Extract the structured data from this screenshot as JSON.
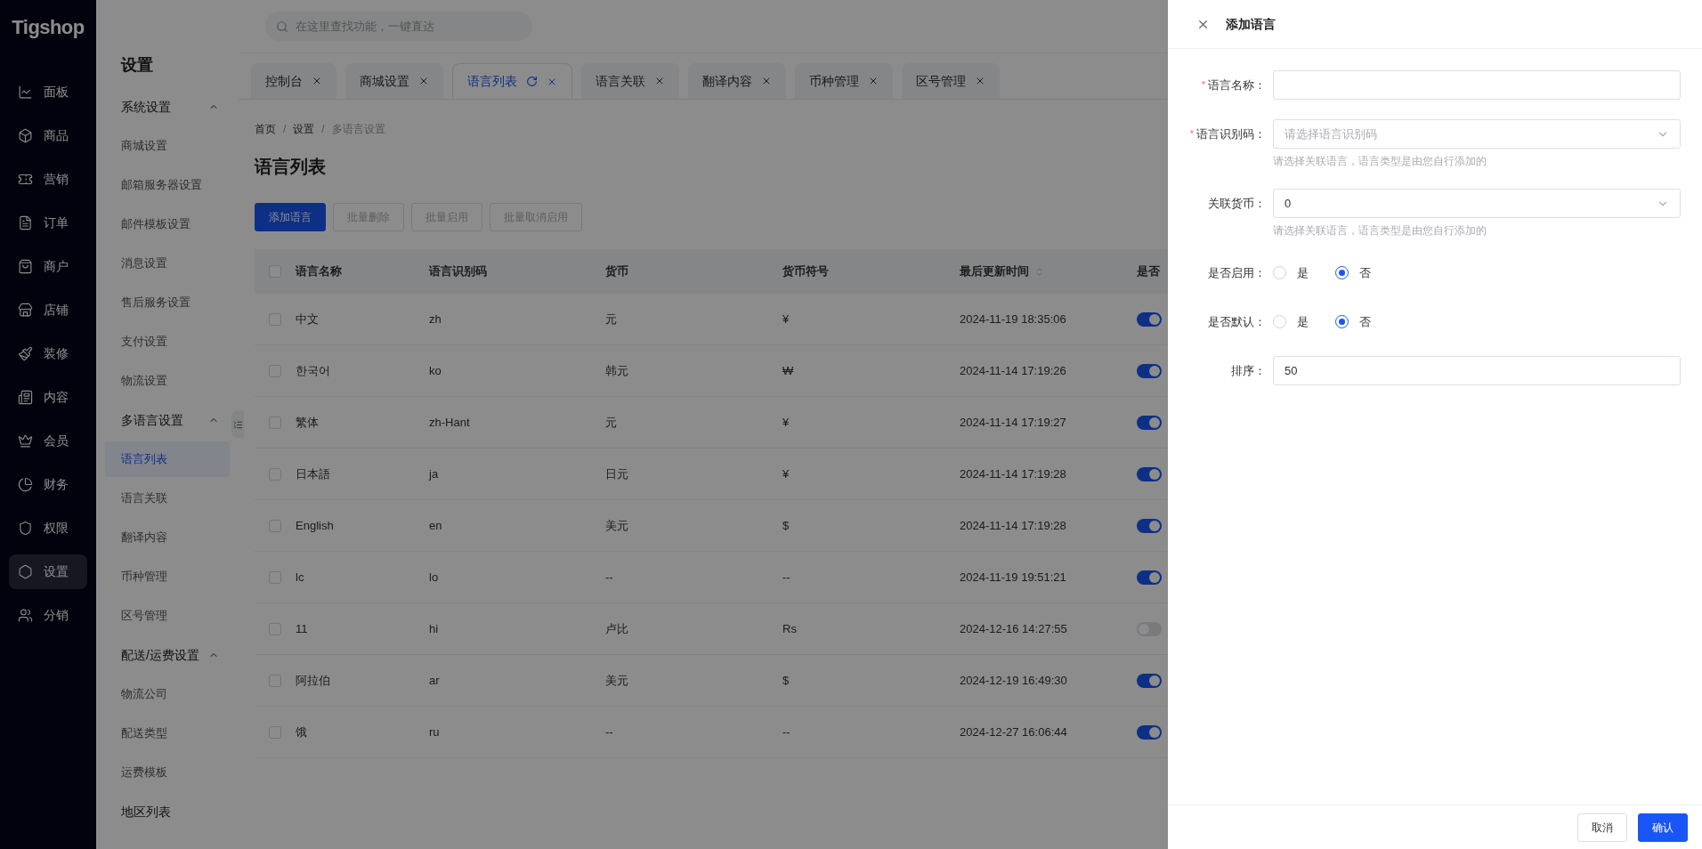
{
  "logo": "Tigshop",
  "search": {
    "placeholder": "在这里查找功能，一键直达"
  },
  "nav": [
    {
      "label": "面板",
      "selected": false
    },
    {
      "label": "商品",
      "selected": false
    },
    {
      "label": "营销",
      "selected": false
    },
    {
      "label": "订单",
      "selected": false
    },
    {
      "label": "商户",
      "selected": false
    },
    {
      "label": "店铺",
      "selected": false
    },
    {
      "label": "装修",
      "selected": false
    },
    {
      "label": "内容",
      "selected": false
    },
    {
      "label": "会员",
      "selected": false
    },
    {
      "label": "财务",
      "selected": false
    },
    {
      "label": "权限",
      "selected": false
    },
    {
      "label": "设置",
      "selected": true
    },
    {
      "label": "分销",
      "selected": false
    }
  ],
  "submenu": {
    "title": "设置",
    "groups": [
      {
        "kind": "group",
        "label": "系统设置",
        "expanded": true,
        "items": [
          {
            "label": "商城设置",
            "selected": false
          },
          {
            "label": "邮箱服务器设置",
            "selected": false
          },
          {
            "label": "邮件模板设置",
            "selected": false
          },
          {
            "label": "消息设置",
            "selected": false
          },
          {
            "label": "售后服务设置",
            "selected": false
          },
          {
            "label": "支付设置",
            "selected": false
          },
          {
            "label": "物流设置",
            "selected": false
          }
        ]
      },
      {
        "kind": "group",
        "label": "多语言设置",
        "expanded": true,
        "items": [
          {
            "label": "语言列表",
            "selected": true
          },
          {
            "label": "语言关联",
            "selected": false
          },
          {
            "label": "翻译内容",
            "selected": false
          },
          {
            "label": "币种管理",
            "selected": false
          },
          {
            "label": "区号管理",
            "selected": false
          }
        ]
      },
      {
        "kind": "group",
        "label": "配送/运费设置",
        "expanded": true,
        "items": [
          {
            "label": "物流公司",
            "selected": false
          },
          {
            "label": "配送类型",
            "selected": false
          },
          {
            "label": "运费模板",
            "selected": false
          }
        ]
      },
      {
        "kind": "link",
        "label": "地区列表"
      }
    ]
  },
  "tabs": [
    {
      "label": "控制台",
      "selected": false
    },
    {
      "label": "商城设置",
      "selected": false
    },
    {
      "label": "语言列表",
      "selected": true
    },
    {
      "label": "语言关联",
      "selected": false
    },
    {
      "label": "翻译内容",
      "selected": false
    },
    {
      "label": "币种管理",
      "selected": false
    },
    {
      "label": "区号管理",
      "selected": false
    }
  ],
  "breadcrumb": [
    {
      "label": "首页"
    },
    {
      "separator": "/",
      "label": "设置"
    },
    {
      "separator": "/",
      "label": "多语言设置"
    }
  ],
  "page_title": "语言列表",
  "toolbar": [
    {
      "label": "添加语言",
      "kind": "primary",
      "disabled": false
    },
    {
      "label": "批量删除",
      "kind": "default",
      "disabled": true
    },
    {
      "label": "批量启用",
      "kind": "default",
      "disabled": true
    },
    {
      "label": "批量取消启用",
      "kind": "default",
      "disabled": true
    }
  ],
  "table": {
    "header_checked": false,
    "columns": [
      "语言名称",
      "语言识别码",
      "货币",
      "货币符号",
      "最后更新时间",
      "是否"
    ],
    "rows": [
      {
        "checked": false,
        "cells": [
          "中文",
          "zh",
          "元",
          "¥",
          "2024-11-19 18:35:06"
        ],
        "on": true
      },
      {
        "checked": false,
        "cells": [
          "한국어",
          "ko",
          "韩元",
          "₩",
          "2024-11-14 17:19:26"
        ],
        "on": true
      },
      {
        "checked": false,
        "cells": [
          "繁体",
          "zh-Hant",
          "元",
          "¥",
          "2024-11-14 17:19:27"
        ],
        "on": true
      },
      {
        "checked": false,
        "cells": [
          "日本語",
          "ja",
          "日元",
          "¥",
          "2024-11-14 17:19:28"
        ],
        "on": true
      },
      {
        "checked": false,
        "cells": [
          "English",
          "en",
          "美元",
          "$",
          "2024-11-14 17:19:28"
        ],
        "on": true
      },
      {
        "checked": false,
        "cells": [
          "lc",
          "lo",
          "--",
          "--",
          "2024-11-19 19:51:21"
        ],
        "on": true
      },
      {
        "checked": false,
        "cells": [
          "11",
          "hi",
          "卢比",
          "Rs",
          "2024-12-16 14:27:55"
        ],
        "on": false
      },
      {
        "checked": false,
        "cells": [
          "阿拉伯",
          "ar",
          "美元",
          "$",
          "2024-12-19 16:49:30"
        ],
        "on": true
      },
      {
        "checked": false,
        "cells": [
          "饿",
          "ru",
          "--",
          "--",
          "2024-12-27 16:06:44"
        ],
        "on": true
      }
    ]
  },
  "drawer": {
    "title": "添加语言",
    "fields": [
      {
        "kind": "text",
        "label": "语言名称：",
        "required_mark": "*"
      },
      {
        "kind": "select",
        "label": "语言识别码：",
        "required_mark": "*",
        "placeholder": "请选择语言识别码",
        "hint": "请选择关联语言，语言类型是由您自行添加的"
      },
      {
        "kind": "select",
        "label": "关联货币：",
        "value": "0",
        "hint": "请选择关联语言，语言类型是由您自行添加的"
      },
      {
        "kind": "radio",
        "label": "是否启用：",
        "options": [
          {
            "label": "是",
            "selected": false
          },
          {
            "label": "否",
            "selected": true
          }
        ]
      },
      {
        "kind": "radio",
        "label": "是否默认：",
        "options": [
          {
            "label": "是",
            "selected": false
          },
          {
            "label": "否",
            "selected": true
          }
        ]
      },
      {
        "kind": "text",
        "label": "排序：",
        "value": "50"
      }
    ],
    "buttons": [
      {
        "label": "取消",
        "kind": "default"
      },
      {
        "label": "确认",
        "kind": "primary"
      }
    ]
  }
}
